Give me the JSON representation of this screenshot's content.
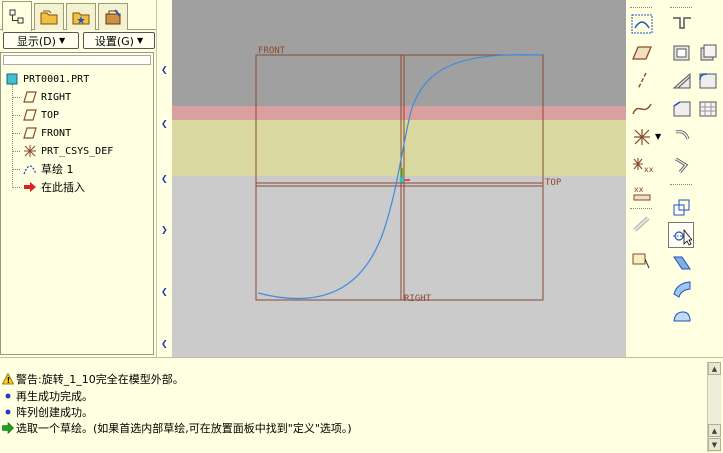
{
  "left_panel": {
    "buttons": {
      "display_label": "显示(D)",
      "settings_label": "设置(G)"
    },
    "tree": {
      "items": [
        {
          "label": "PRT0001.PRT",
          "icon": "part-icon"
        },
        {
          "label": "RIGHT",
          "icon": "datum-plane-icon"
        },
        {
          "label": "TOP",
          "icon": "datum-plane-icon"
        },
        {
          "label": "FRONT",
          "icon": "datum-plane-icon"
        },
        {
          "label": "PRT_CSYS_DEF",
          "icon": "coordinate-system-icon"
        },
        {
          "label": "草绘 1",
          "icon": "sketch-icon"
        },
        {
          "label": "在此插入",
          "icon": "insert-here-arrow-icon"
        }
      ]
    }
  },
  "graphics": {
    "plane_labels": {
      "front": "FRONT",
      "top": "TOP",
      "right": "RIGHT"
    },
    "colors": {
      "background": "#cbcbcb",
      "top_band": "#a0a0a0",
      "highlight_red": "#d9a0a0",
      "highlight_yellow": "#d8d8a0",
      "plane_outline": "#8a4a30",
      "curve": "#3c8ae0"
    }
  },
  "messages": [
    {
      "icon": "warning-icon",
      "text": "警告:旋转_1_10完全在模型外部。"
    },
    {
      "icon": "info-dot-icon",
      "text": "再生成功完成。"
    },
    {
      "icon": "info-dot-icon",
      "text": "阵列创建成功。"
    },
    {
      "icon": "prompt-arrow-icon",
      "text": "选取一个草绘。(如果首选内部草绘,可在放置面板中找到\"定义\"选项。)"
    }
  ]
}
